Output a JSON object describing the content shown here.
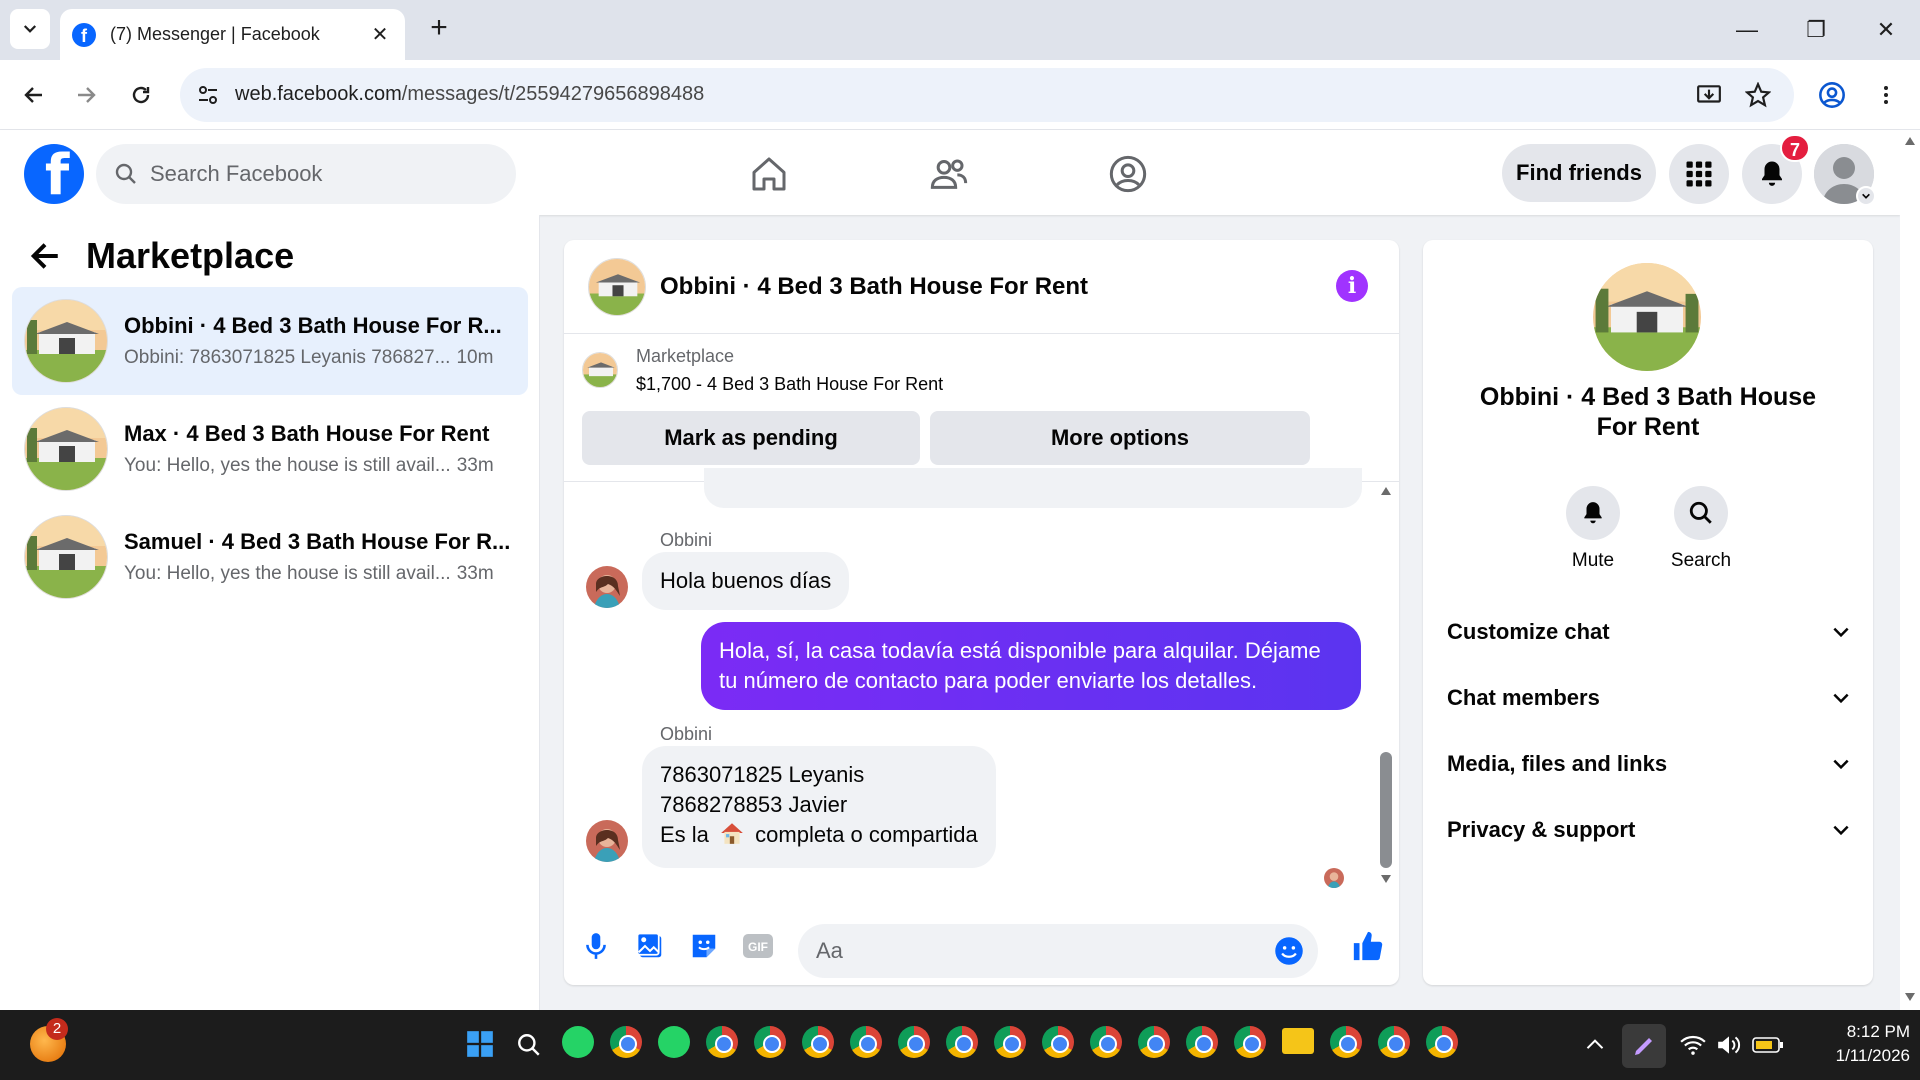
{
  "browser": {
    "tab_title": "(7) Messenger | Facebook",
    "url_host": "web.facebook.com",
    "url_path": "/messages/t/25594279656898488"
  },
  "fb": {
    "search_placeholder": "Search Facebook",
    "find_friends": "Find friends",
    "notification_count": "7"
  },
  "sidebar": {
    "title": "Marketplace",
    "conversations": [
      {
        "name": "Obbini · 4 Bed 3 Bath House For R...",
        "snippet": "Obbini: 7863071825 Leyanis 786827...",
        "time": "10m",
        "active": true
      },
      {
        "name": "Max · 4 Bed 3 Bath House For Rent",
        "snippet": "You: Hello, yes the house is still avail...",
        "time": "33m",
        "active": false
      },
      {
        "name": "Samuel · 4 Bed 3 Bath House For R...",
        "snippet": "You: Hello, yes the house is still avail...",
        "time": "33m",
        "active": false
      }
    ]
  },
  "chat": {
    "title": "Obbini · 4 Bed 3 Bath House For Rent",
    "marketplace_label": "Marketplace",
    "listing": "$1,700 - 4 Bed 3 Bath House For Rent",
    "mark_pending": "Mark as pending",
    "more_options": "More options",
    "messages": [
      {
        "sender": "Obbini",
        "text": "Hola buenos días"
      },
      {
        "sender": "You",
        "text": "Hola, sí, la casa todavía está disponible para alquilar. Déjame tu número de contacto para poder enviarte los detalles."
      },
      {
        "sender": "Obbini",
        "lines": [
          "7863071825 Leyanis",
          "7868278853 Javier",
          "Es la",
          "completa o compartida"
        ]
      }
    ],
    "composer_placeholder": "Aa"
  },
  "info_panel": {
    "title": "Obbini · 4 Bed 3 Bath House For Rent",
    "mute": "Mute",
    "search": "Search",
    "sections": [
      "Customize chat",
      "Chat members",
      "Media, files and links",
      "Privacy & support"
    ]
  },
  "taskbar": {
    "weather_badge": "2",
    "time": "8:12 PM",
    "date": "1/11/2026"
  },
  "colors": {
    "fb_blue": "#0866ff",
    "outgoing_bubble": "#6a2ff3",
    "active_conversation": "#e7f0fd",
    "notification_red": "#e41e3f",
    "info_purple": "#a033ff"
  }
}
